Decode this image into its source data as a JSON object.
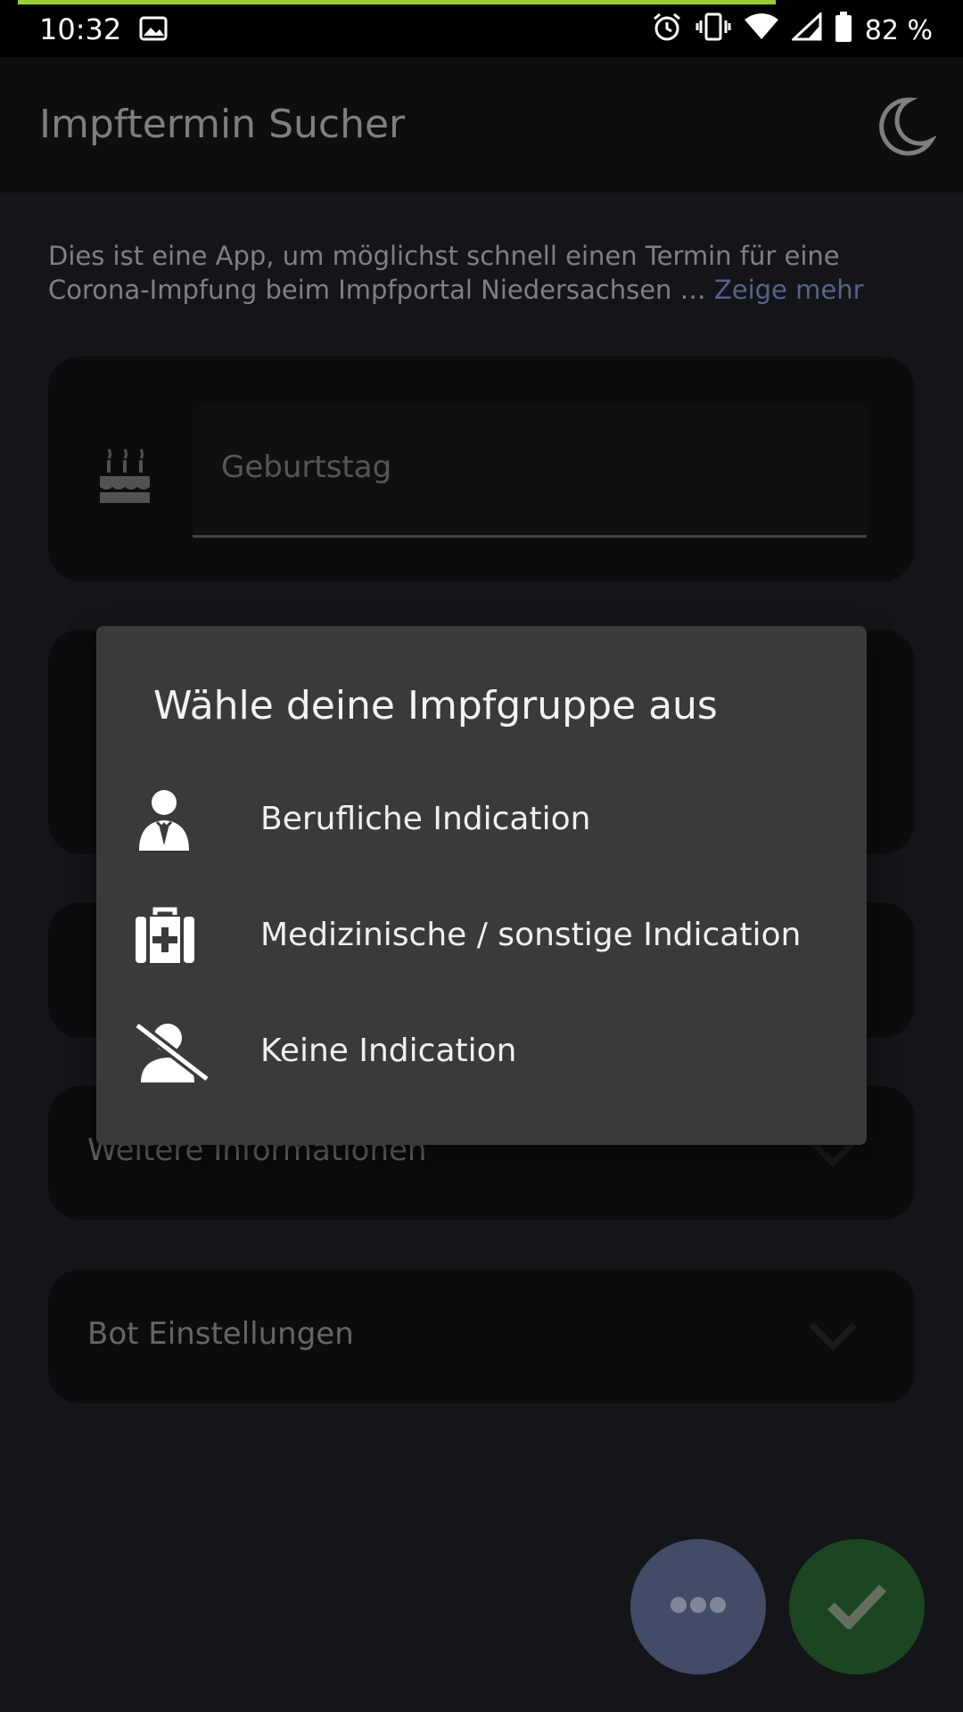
{
  "status_bar": {
    "time": "10:32",
    "battery": "82 %",
    "icons": [
      "image-icon",
      "alarm-icon",
      "vibrate-icon",
      "wifi-icon",
      "signal-icon",
      "battery-icon"
    ]
  },
  "app_bar": {
    "title": "Impftermin Sucher",
    "theme_icon": "moon-icon"
  },
  "intro": {
    "text": "Dies ist eine App, um möglichst schnell einen Termin für eine Corona-Impfung beim Impfportal Niedersachsen … ",
    "more_link": "Zeige mehr"
  },
  "form": {
    "birthday_placeholder": "Geburtstag",
    "birthday_icon": "cake-icon",
    "sections": [
      {
        "label": "Weitere Informationen"
      },
      {
        "label": "Bot Einstellungen"
      }
    ]
  },
  "dialog": {
    "title": "Wähle deine Impfgruppe aus",
    "options": [
      {
        "label": "Berufliche Indication",
        "icon": "person-tie-icon"
      },
      {
        "label": "Medizinische / sonstige Indication",
        "icon": "medical-kit-icon"
      },
      {
        "label": "Keine Indication",
        "icon": "person-off-icon"
      }
    ]
  },
  "fabs": {
    "more_icon": "more-horiz-icon",
    "confirm_icon": "check-icon"
  },
  "colors": {
    "background": "#16171b",
    "dialog": "#3a3a3c",
    "accent_link": "#5d6d95",
    "fab_more": "#4a5270",
    "fab_confirm": "#1e4d24",
    "progress": "#9acd32"
  }
}
